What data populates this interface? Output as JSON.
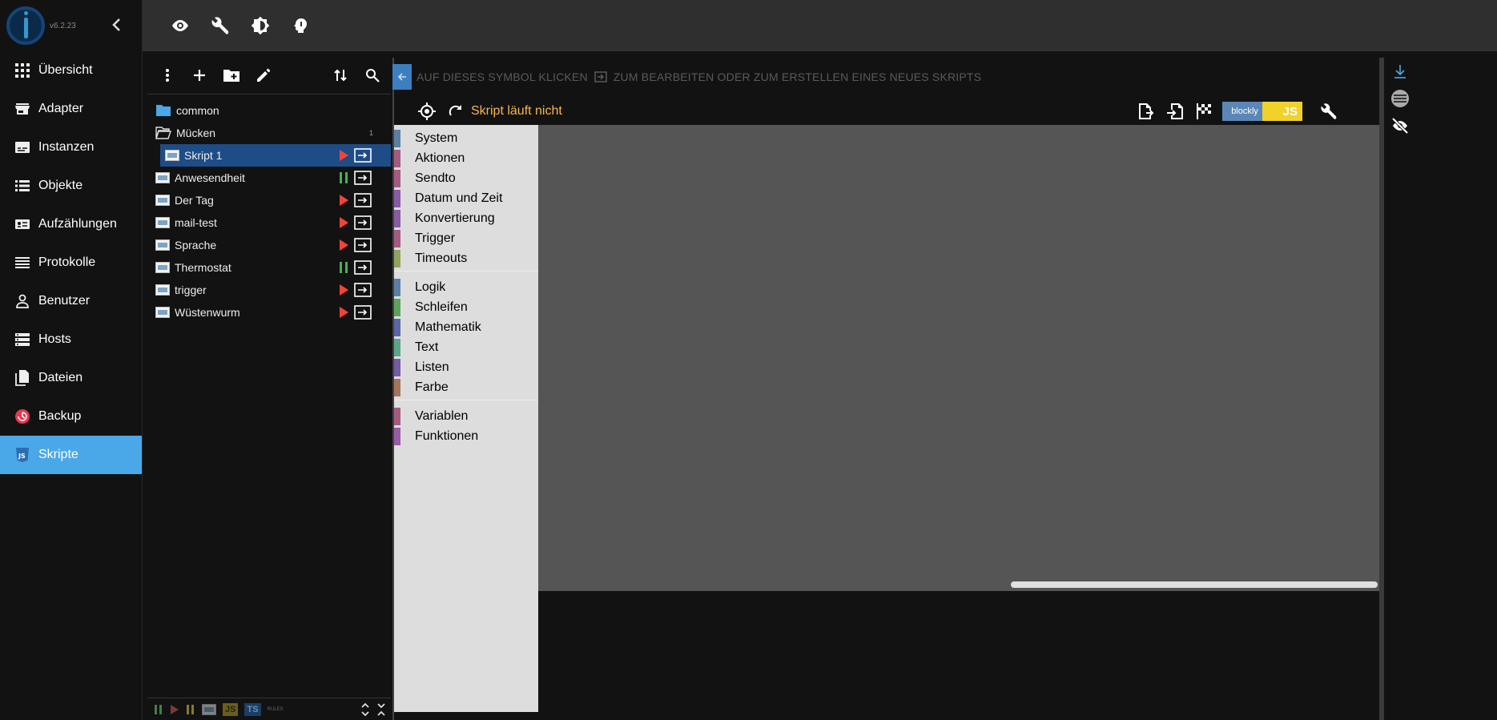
{
  "app": {
    "version": "v6.2.23"
  },
  "nav": {
    "items": [
      {
        "label": "Übersicht",
        "icon": "apps-icon"
      },
      {
        "label": "Adapter",
        "icon": "store-icon"
      },
      {
        "label": "Instanzen",
        "icon": "instances-icon"
      },
      {
        "label": "Objekte",
        "icon": "list-icon"
      },
      {
        "label": "Aufzählungen",
        "icon": "enum-icon"
      },
      {
        "label": "Protokolle",
        "icon": "log-icon"
      },
      {
        "label": "Benutzer",
        "icon": "user-icon"
      },
      {
        "label": "Hosts",
        "icon": "hosts-icon"
      },
      {
        "label": "Dateien",
        "icon": "files-icon"
      },
      {
        "label": "Backup",
        "icon": "backup-icon"
      },
      {
        "label": "Skripte",
        "icon": "js-icon"
      }
    ],
    "active": "Skripte"
  },
  "tree": {
    "folders": [
      {
        "name": "common"
      },
      {
        "name": "Mücken",
        "count": "1"
      }
    ],
    "scripts": [
      {
        "name": "Skript 1",
        "state": "stopped",
        "selected": true
      },
      {
        "name": "Anwesendheit",
        "state": "running"
      },
      {
        "name": "Der Tag",
        "state": "stopped"
      },
      {
        "name": "mail-test",
        "state": "stopped"
      },
      {
        "name": "Sprache",
        "state": "stopped"
      },
      {
        "name": "Thermostat",
        "state": "running"
      },
      {
        "name": "trigger",
        "state": "stopped"
      },
      {
        "name": "Wüstenwurm",
        "state": "stopped"
      }
    ],
    "bottom": {
      "js": "JS",
      "ts": "TS",
      "rules": "RULES"
    }
  },
  "editor": {
    "hint_part1": "AUF DIESES SYMBOL KLICKEN",
    "hint_part2": "ZUM BEARBEITEN ODER ZUM ERSTELLEN EINES NEUES SKRIPTS",
    "status": "Skript läuft nicht",
    "blockly_label": "blockly",
    "js_label": "JS"
  },
  "toolbox": {
    "group1": [
      {
        "label": "System",
        "color": "#5b80a5"
      },
      {
        "label": "Aktionen",
        "color": "#a55b80"
      },
      {
        "label": "Sendto",
        "color": "#a55b80"
      },
      {
        "label": "Datum und Zeit",
        "color": "#8a5ba5"
      },
      {
        "label": "Konvertierung",
        "color": "#8a5ba5"
      },
      {
        "label": "Trigger",
        "color": "#a55b80"
      },
      {
        "label": "Timeouts",
        "color": "#8fa55b"
      }
    ],
    "group2": [
      {
        "label": "Logik",
        "color": "#5b80a5"
      },
      {
        "label": "Schleifen",
        "color": "#5ba55b"
      },
      {
        "label": "Mathematik",
        "color": "#5b67a5"
      },
      {
        "label": "Text",
        "color": "#5ba58c"
      },
      {
        "label": "Listen",
        "color": "#745ba5"
      },
      {
        "label": "Farbe",
        "color": "#a5745b"
      }
    ],
    "group3": [
      {
        "label": "Variablen",
        "color": "#a55b80"
      },
      {
        "label": "Funktionen",
        "color": "#995ba5"
      }
    ]
  },
  "colors": {
    "accent": "#4aa8e8",
    "selected_row": "#1e4c86",
    "status": "#f7b84b",
    "stopped": "#f44336",
    "running": "#4caf50"
  }
}
